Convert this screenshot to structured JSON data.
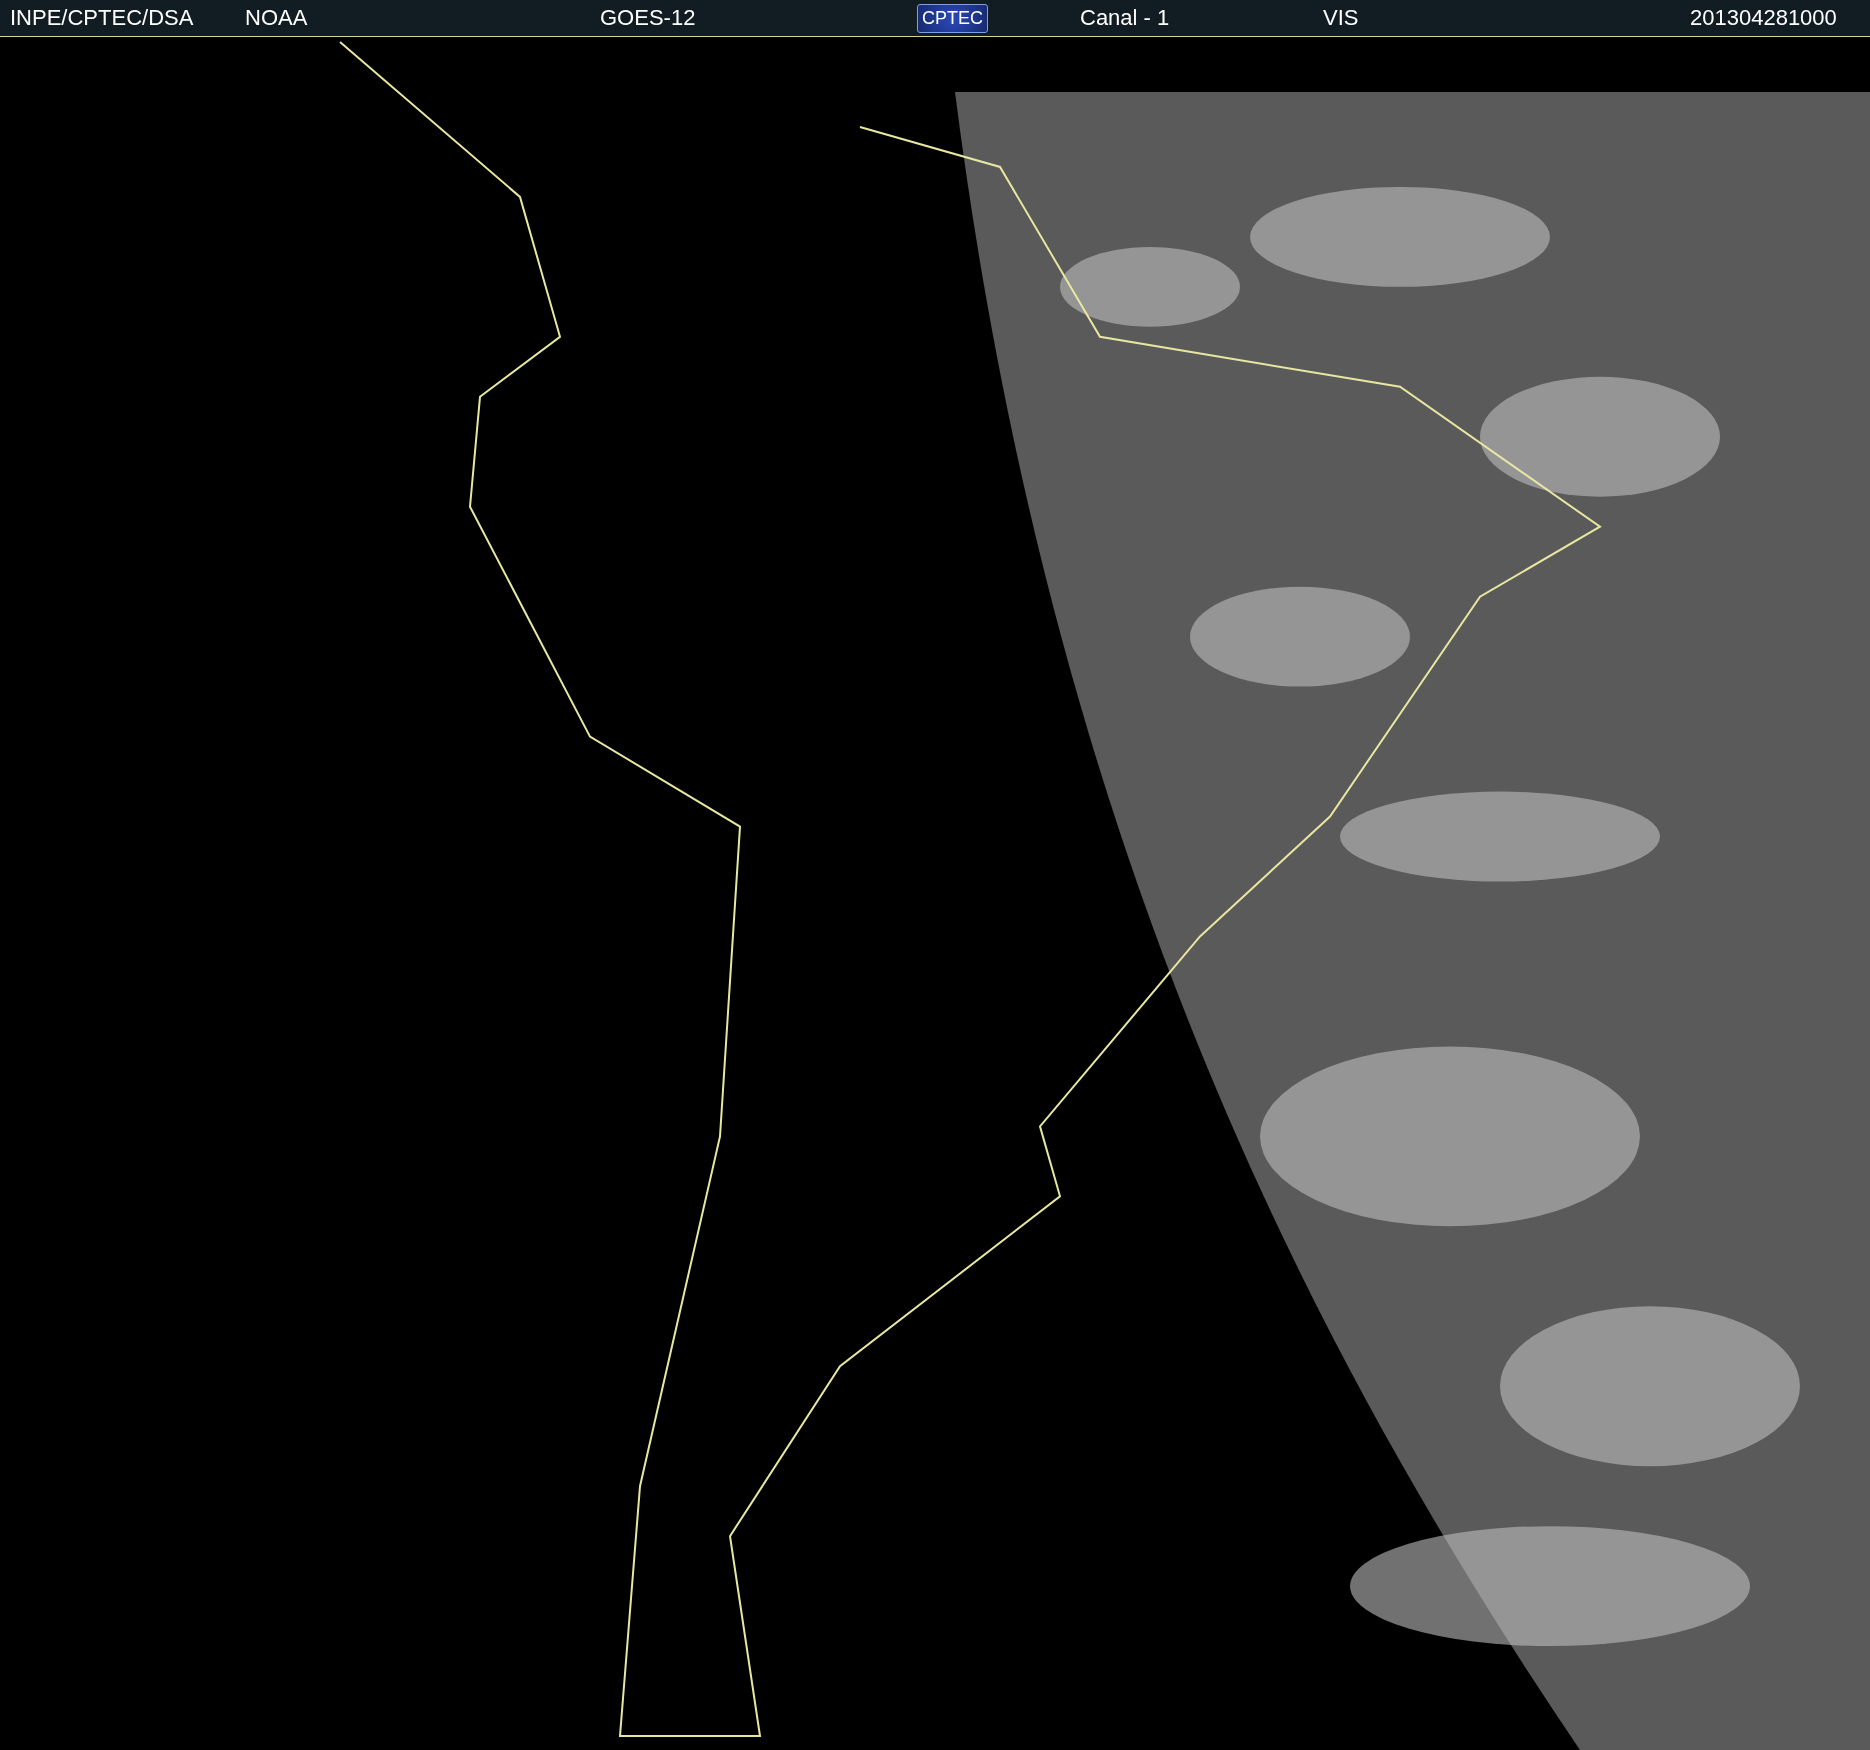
{
  "header": {
    "items": [
      {
        "kind": "text",
        "text": "INPE/CPTEC/DSA"
      },
      {
        "kind": "text",
        "text": "NOAA"
      },
      {
        "kind": "text",
        "text": "GOES-12"
      },
      {
        "kind": "logo",
        "text": "CPTEC"
      },
      {
        "kind": "text",
        "text": "Canal - 1"
      },
      {
        "kind": "text",
        "text": "VIS"
      },
      {
        "kind": "text",
        "text": "201304281000"
      }
    ]
  }
}
